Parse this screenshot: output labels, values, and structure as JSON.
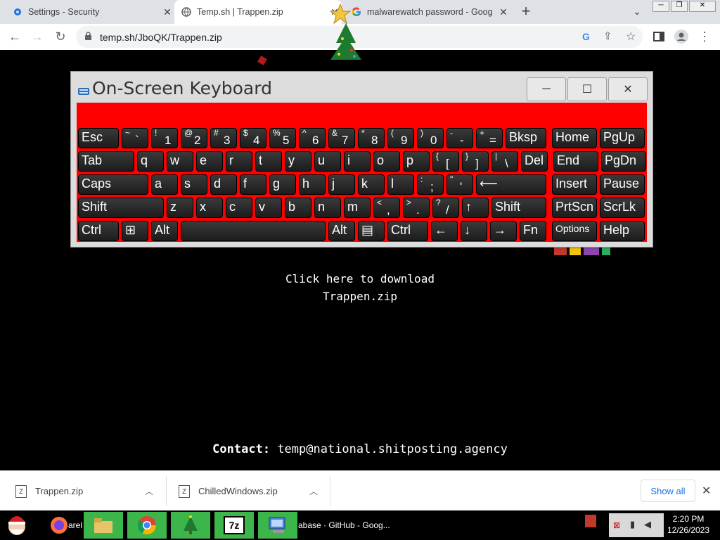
{
  "browser": {
    "tabs": [
      {
        "title": "Settings - Security",
        "icon": "gear-icon"
      },
      {
        "title": "Temp.sh | Trappen.zip",
        "icon": "globe-icon"
      },
      {
        "title": "malwarewatch password - Goog",
        "icon": "google-icon"
      }
    ],
    "new_tab_label": "+",
    "url": "temp.sh/JboQK/Trappen.zip"
  },
  "page": {
    "download_line1": "Click here to download",
    "download_line2": "Trappen.zip",
    "contact_label": "Contact:",
    "contact_value": "temp@national.shitposting.agency"
  },
  "osk": {
    "title": "On-Screen Keyboard",
    "accent_color": "#ff0000",
    "rows": [
      [
        {
          "label": "Esc"
        },
        {
          "shift": "~",
          "main": "`"
        },
        {
          "shift": "!",
          "main": "1"
        },
        {
          "shift": "@",
          "main": "2"
        },
        {
          "shift": "#",
          "main": "3"
        },
        {
          "shift": "$",
          "main": "4"
        },
        {
          "shift": "%",
          "main": "5"
        },
        {
          "shift": "^",
          "main": "6"
        },
        {
          "shift": "&",
          "main": "7"
        },
        {
          "shift": "*",
          "main": "8"
        },
        {
          "shift": "(",
          "main": "9"
        },
        {
          "shift": ")",
          "main": "0"
        },
        {
          "shift": "-",
          "main": "-"
        },
        {
          "shift": "+",
          "main": "="
        },
        {
          "label": "Bksp"
        },
        {
          "label": "Home"
        },
        {
          "label": "PgUp"
        }
      ],
      [
        {
          "label": "Tab"
        },
        {
          "label": "q"
        },
        {
          "label": "w"
        },
        {
          "label": "e"
        },
        {
          "label": "r"
        },
        {
          "label": "t"
        },
        {
          "label": "y"
        },
        {
          "label": "u"
        },
        {
          "label": "i"
        },
        {
          "label": "o"
        },
        {
          "label": "p"
        },
        {
          "shift": "{",
          "main": "["
        },
        {
          "shift": "}",
          "main": "]"
        },
        {
          "shift": "|",
          "main": "\\"
        },
        {
          "label": "Del"
        },
        {
          "label": "End"
        },
        {
          "label": "PgDn"
        }
      ],
      [
        {
          "label": "Caps"
        },
        {
          "label": "a"
        },
        {
          "label": "s"
        },
        {
          "label": "d"
        },
        {
          "label": "f"
        },
        {
          "label": "g"
        },
        {
          "label": "h"
        },
        {
          "label": "j"
        },
        {
          "label": "k"
        },
        {
          "label": "l"
        },
        {
          "shift": ":",
          "main": ";"
        },
        {
          "shift": "\"",
          "main": "'"
        },
        {
          "label": "⟵"
        },
        {
          "label": "Insert"
        },
        {
          "label": "Pause"
        }
      ],
      [
        {
          "label": "Shift"
        },
        {
          "label": "z"
        },
        {
          "label": "x"
        },
        {
          "label": "c"
        },
        {
          "label": "v"
        },
        {
          "label": "b"
        },
        {
          "label": "n"
        },
        {
          "label": "m"
        },
        {
          "shift": "<",
          "main": ","
        },
        {
          "shift": ">",
          "main": "."
        },
        {
          "shift": "?",
          "main": "/"
        },
        {
          "label": "↑"
        },
        {
          "label": "Shift"
        },
        {
          "label": "PrtScn"
        },
        {
          "label": "ScrLk"
        }
      ],
      [
        {
          "label": "Ctrl"
        },
        {
          "label": "⊞"
        },
        {
          "label": "Alt"
        },
        {
          "label": ""
        },
        {
          "label": "Alt"
        },
        {
          "label": "▤"
        },
        {
          "label": "Ctrl"
        },
        {
          "label": "←"
        },
        {
          "label": "↓"
        },
        {
          "label": "→"
        },
        {
          "label": "Fn"
        },
        {
          "label": "Options"
        },
        {
          "label": "Help"
        }
      ]
    ]
  },
  "downloads": {
    "items": [
      {
        "name": "Trappen.zip"
      },
      {
        "name": "ChilledWindows.zip"
      }
    ],
    "show_all": "Show all"
  },
  "taskbar": {
    "partial_label_left": "arel",
    "partial_label_github": "abase · GitHub - Goog...",
    "time": "2:20 PM",
    "date": "12/26/2023"
  }
}
